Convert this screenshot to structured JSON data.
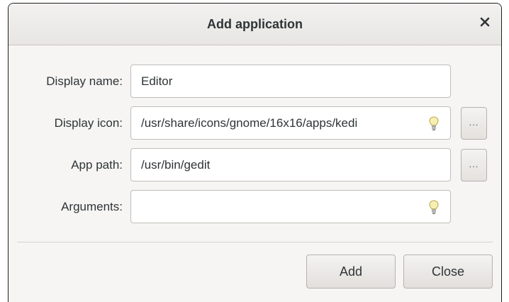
{
  "dialog": {
    "title": "Add application",
    "close_glyph": "×"
  },
  "form": {
    "display_name": {
      "label": "Display name:",
      "value": "Editor"
    },
    "display_icon": {
      "label": "Display icon:",
      "value": "/usr/share/icons/gnome/16x16/apps/kedi",
      "browse_label": "..."
    },
    "app_path": {
      "label": "App path:",
      "value": "/usr/bin/gedit",
      "browse_label": "..."
    },
    "arguments": {
      "label": "Arguments:",
      "value": ""
    }
  },
  "buttons": {
    "add_label": "Add",
    "close_label": "Close"
  },
  "icons": {
    "close": "close-icon",
    "hint": "lightbulb-icon"
  },
  "colors": {
    "window_bg": "#f6f5f4",
    "entry_bg": "#ffffff",
    "text": "#2e3436"
  }
}
